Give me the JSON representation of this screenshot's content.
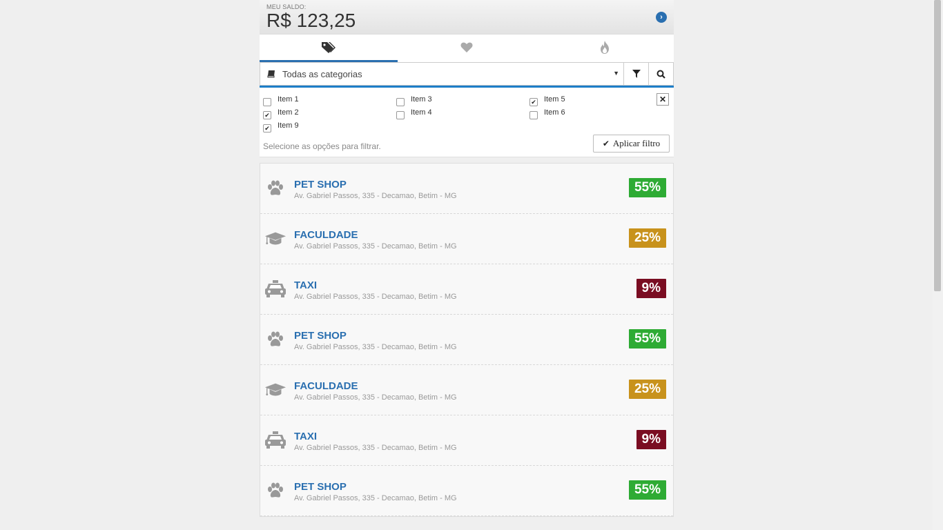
{
  "balance": {
    "label": "MEU SALDO:",
    "amount": "R$ 123,25"
  },
  "tabs": [
    {
      "icon": "tags-icon",
      "active": true
    },
    {
      "icon": "heart-icon",
      "active": false
    },
    {
      "icon": "fire-icon",
      "active": false
    }
  ],
  "search": {
    "category": "Todas as categorias"
  },
  "filters": {
    "options": [
      {
        "label": "Item 1",
        "checked": false
      },
      {
        "label": "Item 3",
        "checked": false
      },
      {
        "label": "Item 5",
        "checked": true
      },
      {
        "label": "Item 2",
        "checked": true
      },
      {
        "label": "Item 4",
        "checked": false
      },
      {
        "label": "Item 6",
        "checked": false
      },
      {
        "label": "Item 9",
        "checked": true
      }
    ],
    "hint": "Selecione as opções para filtrar.",
    "apply_label": "Aplicar filtro"
  },
  "colors": {
    "accent": "#2a6fb0",
    "green": "#2eab34",
    "gold": "#c8921c",
    "wine": "#7a0d22"
  },
  "places": [
    {
      "name": "PET SHOP",
      "address": "Av. Gabriel Passos, 335 - Decamao, Betim - MG",
      "discount": "55%",
      "icon": "paw-icon",
      "color": "#2eab34"
    },
    {
      "name": "FACULDADE",
      "address": "Av. Gabriel Passos, 335 - Decamao, Betim - MG",
      "discount": "25%",
      "icon": "graduation-cap-icon",
      "color": "#c8921c"
    },
    {
      "name": "TAXI",
      "address": "Av. Gabriel Passos, 335 - Decamao, Betim - MG",
      "discount": "9%",
      "icon": "taxi-icon",
      "color": "#7a0d22"
    },
    {
      "name": "PET SHOP",
      "address": "Av. Gabriel Passos, 335 - Decamao, Betim - MG",
      "discount": "55%",
      "icon": "paw-icon",
      "color": "#2eab34"
    },
    {
      "name": "FACULDADE",
      "address": "Av. Gabriel Passos, 335 - Decamao, Betim - MG",
      "discount": "25%",
      "icon": "graduation-cap-icon",
      "color": "#c8921c"
    },
    {
      "name": "TAXI",
      "address": "Av. Gabriel Passos, 335 - Decamao, Betim - MG",
      "discount": "9%",
      "icon": "taxi-icon",
      "color": "#7a0d22"
    },
    {
      "name": "PET SHOP",
      "address": "Av. Gabriel Passos, 335 - Decamao, Betim - MG",
      "discount": "55%",
      "icon": "paw-icon",
      "color": "#2eab34"
    }
  ]
}
